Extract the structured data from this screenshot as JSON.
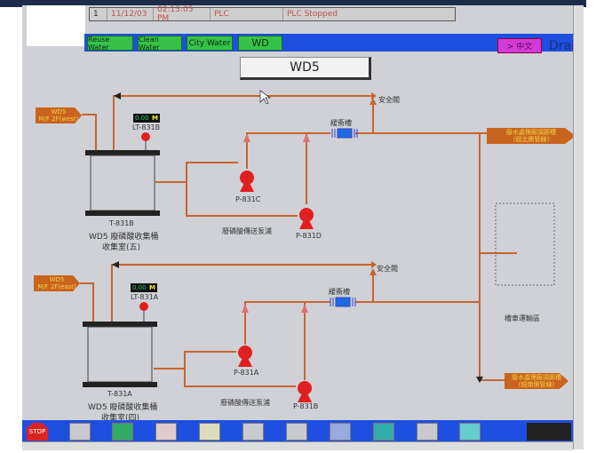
{
  "status": {
    "index": "1",
    "date": "11/12/03",
    "time": "02:13:05 PM",
    "source": "PLC",
    "message": "PLC Stopped"
  },
  "nav": {
    "buttons": [
      "Reuse Water",
      "Clean Water",
      "City Water",
      "WD"
    ],
    "language": "> 中文",
    "drain": "Drai"
  },
  "title": "WD5",
  "upper": {
    "source_tag": [
      "WD5",
      "M/F 2F(west)"
    ],
    "level": "0.00",
    "level_unit": "M",
    "level_id": "LT-831B",
    "tank_id": "T-831B",
    "tank_name": "WD5 廢磷酸收集桶",
    "room": "收集室(五)",
    "pump1": "P-831C",
    "pump2": "P-831D",
    "pump_group": "廢磷酸傳送泵浦",
    "buffer": "緩衝槽",
    "safety_valve": "安全閥",
    "dest_tag": [
      "廢水處理廠調節槽",
      "(經北側管線)"
    ]
  },
  "lower": {
    "source_tag": [
      "WD5",
      "M/F 2F(east)"
    ],
    "level": "0.00",
    "level_unit": "M",
    "level_id": "LT-831A",
    "tank_id": "T-831A",
    "tank_name": "WD5 廢磷酸收集桶",
    "room": "收集室(四)",
    "pump1": "P-831A",
    "pump2": "P-831B",
    "pump_group": "廢磷酸傳送泵浦",
    "buffer": "緩衝槽",
    "safety_valve": "安全閥",
    "dest_tag": [
      "廢水處理廠調節槽",
      "(經南側管線)"
    ]
  },
  "truck_area": "槽車運輸區",
  "toolbar": {
    "stop": "STOP",
    "icons": [
      "trend-icon",
      "panel-icon",
      "alarm-icon",
      "bell-icon",
      "report-icon",
      "graph-icon",
      "window-icon",
      "exit-icon",
      "lock-icon",
      "cursor-icon"
    ]
  },
  "colors": {
    "pipe": "#c8642e",
    "pump": "#e02020",
    "nav": "#1f4fe0",
    "button": "#36c24a"
  }
}
